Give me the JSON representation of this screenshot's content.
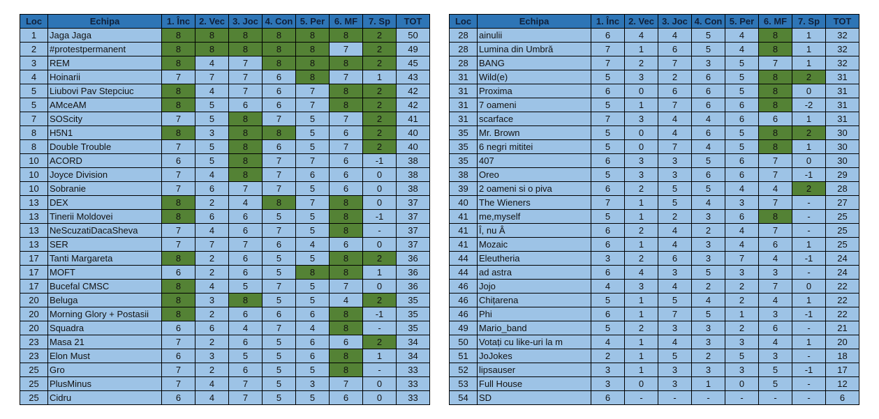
{
  "headers": [
    "Loc",
    "Echipa",
    "1. Înc",
    "2. Vec",
    "3. Joc",
    "4. Con",
    "5. Per",
    "6. MF",
    "7. Sp",
    "TOT"
  ],
  "colors": {
    "header": "#2e75b6",
    "cell": "#9dc3e6",
    "highlight": "#548235"
  },
  "left_rows": [
    [
      "1",
      "Jaga Jaga",
      "8",
      "8",
      "8",
      "8",
      "8",
      "8",
      "2",
      "50"
    ],
    [
      "2",
      "#protestpermanent",
      "8",
      "8",
      "8",
      "8",
      "8",
      "7",
      "2",
      "49"
    ],
    [
      "3",
      "REM",
      "8",
      "4",
      "7",
      "8",
      "8",
      "8",
      "2",
      "45"
    ],
    [
      "4",
      "Hoinarii",
      "7",
      "7",
      "7",
      "6",
      "8",
      "7",
      "1",
      "43"
    ],
    [
      "5",
      "Liubovi Pav Stepciuc",
      "8",
      "4",
      "7",
      "6",
      "7",
      "8",
      "2",
      "42"
    ],
    [
      "5",
      "AMceAM",
      "8",
      "5",
      "6",
      "6",
      "7",
      "8",
      "2",
      "42"
    ],
    [
      "7",
      "SOScity",
      "7",
      "5",
      "8",
      "7",
      "5",
      "7",
      "2",
      "41"
    ],
    [
      "8",
      "H5N1",
      "8",
      "3",
      "8",
      "8",
      "5",
      "6",
      "2",
      "40"
    ],
    [
      "8",
      "Double Trouble",
      "7",
      "5",
      "8",
      "6",
      "5",
      "7",
      "2",
      "40"
    ],
    [
      "10",
      "ACORD",
      "6",
      "5",
      "8",
      "7",
      "7",
      "6",
      "-1",
      "38"
    ],
    [
      "10",
      "Joyce Division",
      "7",
      "4",
      "8",
      "7",
      "6",
      "6",
      "0",
      "38"
    ],
    [
      "10",
      "Sobranie",
      "7",
      "6",
      "7",
      "7",
      "5",
      "6",
      "0",
      "38"
    ],
    [
      "13",
      "DEX",
      "8",
      "2",
      "4",
      "8",
      "7",
      "8",
      "0",
      "37"
    ],
    [
      "13",
      "Tinerii Moldovei",
      "8",
      "6",
      "6",
      "5",
      "5",
      "8",
      "-1",
      "37"
    ],
    [
      "13",
      "NeScuzatiDacaSheva",
      "7",
      "4",
      "6",
      "7",
      "5",
      "8",
      "-",
      "37"
    ],
    [
      "13",
      "SER",
      "7",
      "7",
      "7",
      "6",
      "4",
      "6",
      "0",
      "37"
    ],
    [
      "17",
      "Tanti Margareta",
      "8",
      "2",
      "6",
      "5",
      "5",
      "8",
      "2",
      "36"
    ],
    [
      "17",
      "MOFT",
      "6",
      "2",
      "6",
      "5",
      "8",
      "8",
      "1",
      "36"
    ],
    [
      "17",
      "Bucefal CMSC",
      "8",
      "4",
      "5",
      "7",
      "5",
      "7",
      "0",
      "36"
    ],
    [
      "20",
      "Beluga",
      "8",
      "3",
      "8",
      "5",
      "5",
      "4",
      "2",
      "35"
    ],
    [
      "20",
      "Morning Glory + Postasii",
      "8",
      "2",
      "6",
      "6",
      "6",
      "8",
      "-1",
      "35"
    ],
    [
      "20",
      "Squadra",
      "6",
      "6",
      "4",
      "7",
      "4",
      "8",
      "-",
      "35"
    ],
    [
      "23",
      "Masa 21",
      "7",
      "2",
      "6",
      "5",
      "6",
      "6",
      "2",
      "34"
    ],
    [
      "23",
      "Elon Must",
      "6",
      "3",
      "5",
      "5",
      "6",
      "8",
      "1",
      "34"
    ],
    [
      "25",
      "Gro",
      "7",
      "2",
      "6",
      "5",
      "5",
      "8",
      "-",
      "33"
    ],
    [
      "25",
      "PlusMinus",
      "7",
      "4",
      "7",
      "5",
      "3",
      "7",
      "0",
      "33"
    ],
    [
      "25",
      "Cidru",
      "6",
      "4",
      "7",
      "5",
      "5",
      "6",
      "0",
      "33"
    ]
  ],
  "right_rows": [
    [
      "28",
      "ainulii",
      "6",
      "4",
      "4",
      "5",
      "4",
      "8",
      "1",
      "32"
    ],
    [
      "28",
      "Lumina din Umbră",
      "7",
      "1",
      "6",
      "5",
      "4",
      "8",
      "1",
      "32"
    ],
    [
      "28",
      "BANG",
      "7",
      "2",
      "7",
      "3",
      "5",
      "7",
      "1",
      "32"
    ],
    [
      "31",
      "Wild(e)",
      "5",
      "3",
      "2",
      "6",
      "5",
      "8",
      "2",
      "31"
    ],
    [
      "31",
      "Proxima",
      "6",
      "0",
      "6",
      "6",
      "5",
      "8",
      "0",
      "31"
    ],
    [
      "31",
      "7 oameni",
      "5",
      "1",
      "7",
      "6",
      "6",
      "8",
      "-2",
      "31"
    ],
    [
      "31",
      "scarface",
      "7",
      "3",
      "4",
      "4",
      "6",
      "6",
      "1",
      "31"
    ],
    [
      "35",
      "Mr. Brown",
      "5",
      "0",
      "4",
      "6",
      "5",
      "8",
      "2",
      "30"
    ],
    [
      "35",
      "6 negri mititei",
      "5",
      "0",
      "7",
      "4",
      "5",
      "8",
      "1",
      "30"
    ],
    [
      "35",
      "407",
      "6",
      "3",
      "3",
      "5",
      "6",
      "7",
      "0",
      "30"
    ],
    [
      "38",
      "Oreo",
      "5",
      "3",
      "3",
      "6",
      "6",
      "7",
      "-1",
      "29"
    ],
    [
      "39",
      "2 oameni si o piva",
      "6",
      "2",
      "5",
      "5",
      "4",
      "4",
      "2",
      "28"
    ],
    [
      "40",
      "The Wieners",
      "7",
      "1",
      "5",
      "4",
      "3",
      "7",
      "-",
      "27"
    ],
    [
      "41",
      "me,myself",
      "5",
      "1",
      "2",
      "3",
      "6",
      "8",
      "-",
      "25"
    ],
    [
      "41",
      "Î, nu Â",
      "6",
      "2",
      "4",
      "2",
      "4",
      "7",
      "-",
      "25"
    ],
    [
      "41",
      "Mozaic",
      "6",
      "1",
      "4",
      "3",
      "4",
      "6",
      "1",
      "25"
    ],
    [
      "44",
      "Eleutheria",
      "3",
      "2",
      "6",
      "3",
      "7",
      "4",
      "-1",
      "24"
    ],
    [
      "44",
      "ad astra",
      "6",
      "4",
      "3",
      "5",
      "3",
      "3",
      "-",
      "24"
    ],
    [
      "46",
      "Jojo",
      "4",
      "3",
      "4",
      "2",
      "2",
      "7",
      "0",
      "22"
    ],
    [
      "46",
      "Chițarena",
      "5",
      "1",
      "5",
      "4",
      "2",
      "4",
      "1",
      "22"
    ],
    [
      "46",
      "Phi",
      "6",
      "1",
      "7",
      "5",
      "1",
      "3",
      "-1",
      "22"
    ],
    [
      "49",
      "Mario_band",
      "5",
      "2",
      "3",
      "3",
      "2",
      "6",
      "-",
      "21"
    ],
    [
      "50",
      "Votați cu like-uri la m",
      "4",
      "1",
      "4",
      "3",
      "3",
      "4",
      "1",
      "20"
    ],
    [
      "51",
      "JoJokes",
      "2",
      "1",
      "5",
      "2",
      "5",
      "3",
      "-",
      "18"
    ],
    [
      "52",
      "lipsauser",
      "3",
      "1",
      "3",
      "3",
      "3",
      "5",
      "-1",
      "17"
    ],
    [
      "53",
      "Full House",
      "3",
      "0",
      "3",
      "1",
      "0",
      "5",
      "-",
      "12"
    ],
    [
      "54",
      "SD",
      "6",
      "-",
      "-",
      "-",
      "-",
      "-",
      "-",
      "6"
    ]
  ]
}
